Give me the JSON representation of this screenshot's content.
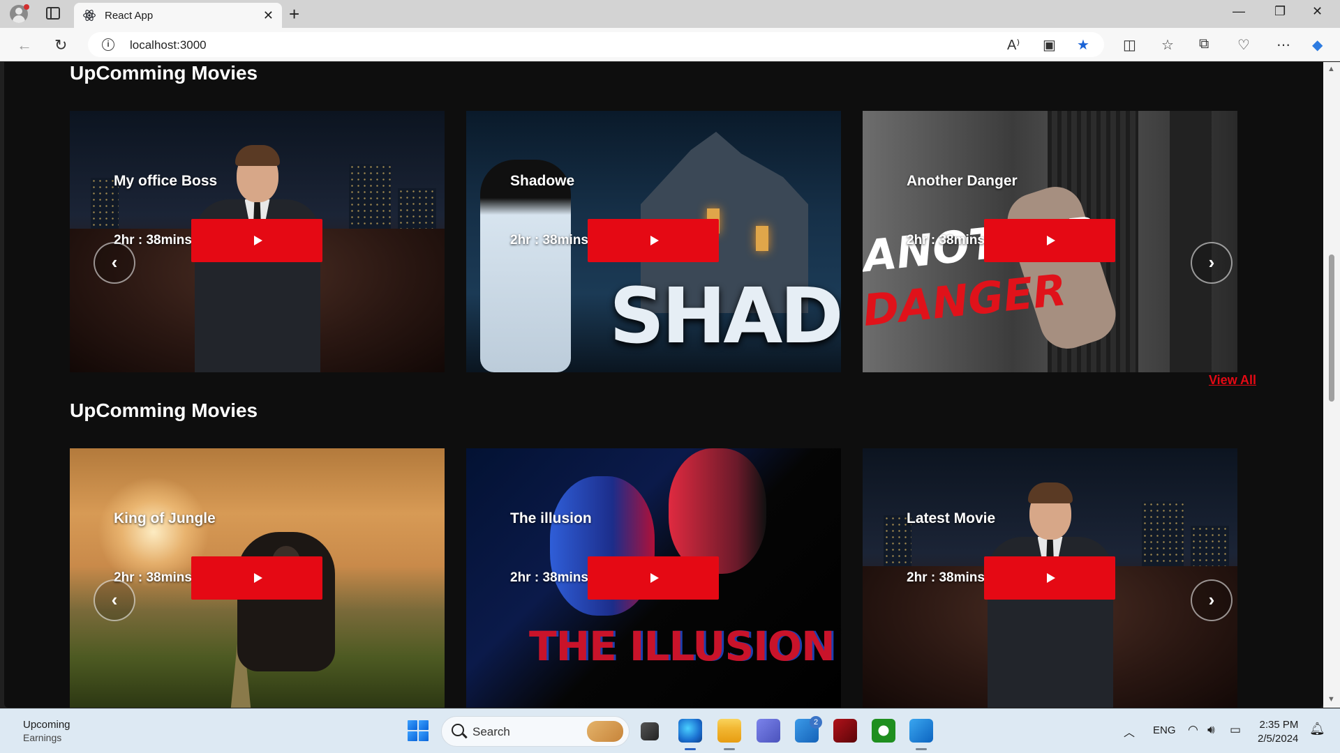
{
  "browser": {
    "tab_title": "React App",
    "url": "localhost:3000"
  },
  "sections": [
    {
      "title": "UpComming Movies",
      "cards": [
        {
          "title": "My office Boss",
          "duration": "2hr : 38mins"
        },
        {
          "title": "Shadowe",
          "duration": "2hr : 38mins",
          "poster_text": "SHADOW"
        },
        {
          "title": "Another Danger",
          "duration": "2hr : 38mins",
          "poster_text_1": "ANOTHER",
          "poster_text_2": "DANGER"
        }
      ],
      "view_all": "View All"
    },
    {
      "title": "UpComming Movies",
      "cards": [
        {
          "title": "King of Jungle",
          "duration": "2hr : 38mins"
        },
        {
          "title": "The illusion",
          "duration": "2hr : 38mins",
          "poster_text": "THE ILLUSION"
        },
        {
          "title": "Latest Movie",
          "duration": "2hr : 38mins"
        }
      ]
    }
  ],
  "carousel": {
    "prev_icon": "‹",
    "next_icon": "›"
  },
  "taskbar": {
    "widget_title": "Upcoming",
    "widget_sub": "Earnings",
    "search_placeholder": "Search",
    "mail_badge": "2",
    "language": "ENG",
    "time": "2:35 PM",
    "date": "2/5/2024"
  },
  "colors": {
    "accent": "#e50914",
    "page_bg": "#0e0e0e"
  }
}
